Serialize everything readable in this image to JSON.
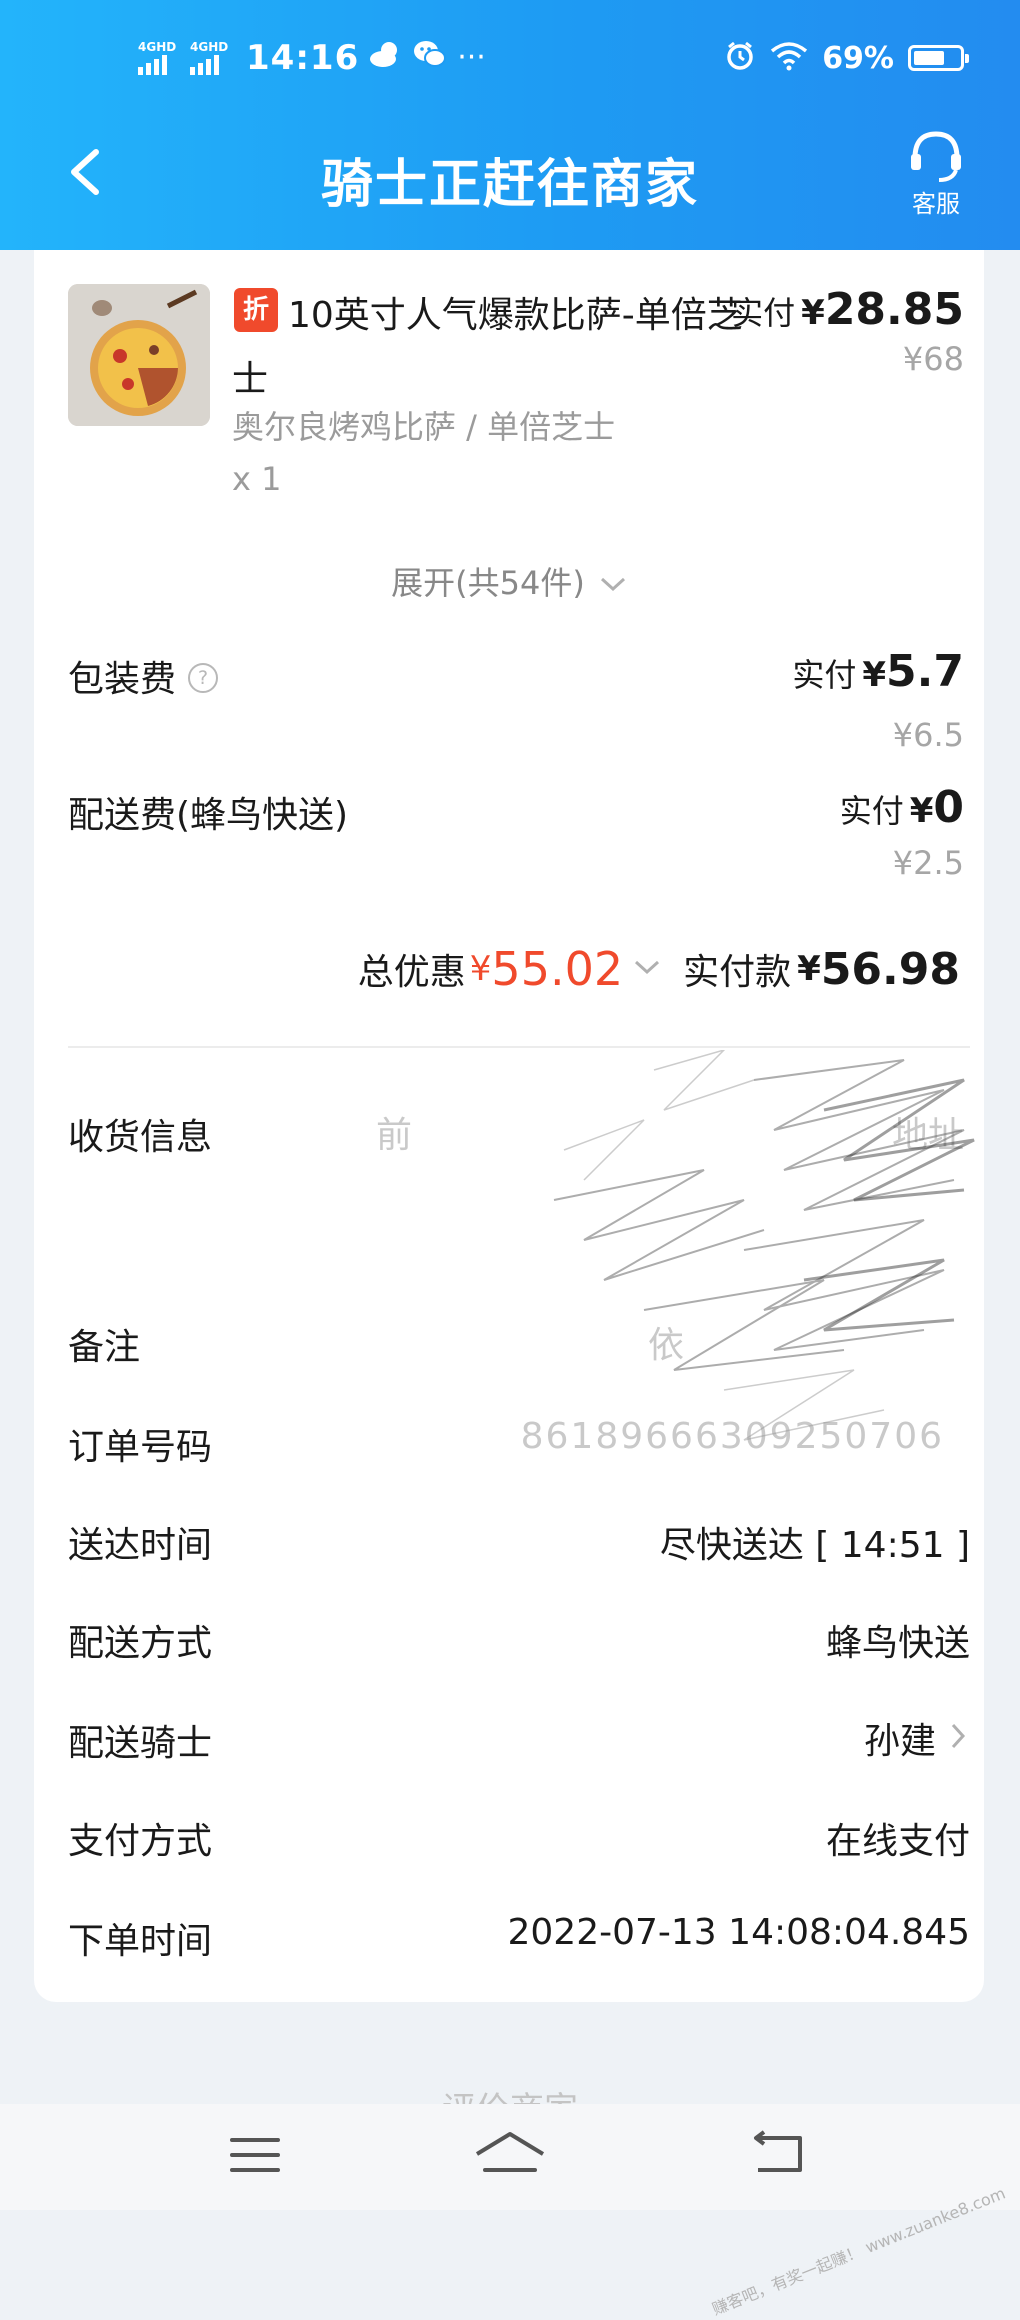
{
  "status_bar": {
    "net1": "4GHD",
    "net2": "4GHD",
    "time": "14:16",
    "more": "···",
    "battery_text": "69%",
    "battery_level": 0.69
  },
  "nav": {
    "title": "骑士正赶往商家",
    "support_label": "客服"
  },
  "item": {
    "badge": "折",
    "name": "10英寸人气爆款比萨-单倍芝士",
    "pay_label": "实付",
    "currency": "¥",
    "pay_amount": "28.85",
    "original_price": "¥68",
    "spec": "奥尔良烤鸡比萨 / 单倍芝士",
    "quantity": "x 1"
  },
  "expand_label": "展开(共54件)",
  "packaging": {
    "label": "包装费",
    "help": "?",
    "pay_label": "实付",
    "currency": "¥",
    "amount": "5.7",
    "original": "¥6.5"
  },
  "delivery_fee": {
    "label": "配送费(蜂鸟快送)",
    "pay_label": "实付",
    "currency": "¥",
    "amount": "0",
    "original": "¥2.5"
  },
  "summary": {
    "discount_label": "总优惠",
    "discount_currency": "¥",
    "discount_amount": "55.02",
    "paid_label": "实付款",
    "paid_currency": "¥",
    "paid_amount": "56.98"
  },
  "info": {
    "receiver_label": "收货信息",
    "receiver_value_visible": "前",
    "receiver_value_tail": "地址",
    "remark_label": "备注",
    "remark_value_visible": "依",
    "order_no_label": "订单号码",
    "order_no_visible": "86189666309250706",
    "delivery_time_label": "送达时间",
    "delivery_time_value": "尽快送达 [ 14:51 ]",
    "delivery_method_label": "配送方式",
    "delivery_method_value": "蜂鸟快送",
    "rider_label": "配送骑士",
    "rider_value": "孙建",
    "payment_method_label": "支付方式",
    "payment_method_value": "在线支付",
    "order_time_label": "下单时间",
    "order_time_value": "2022-07-13 14:08:04.845"
  },
  "bottom_partial_text": "评价商家",
  "watermark": "赚客吧，有奖一起赚！ www.zuanke8.com",
  "colors": {
    "header_start": "#23b4fb",
    "header_end": "#238cf0",
    "discount_red": "#f04a2c",
    "page_bg": "#eef2f6"
  }
}
